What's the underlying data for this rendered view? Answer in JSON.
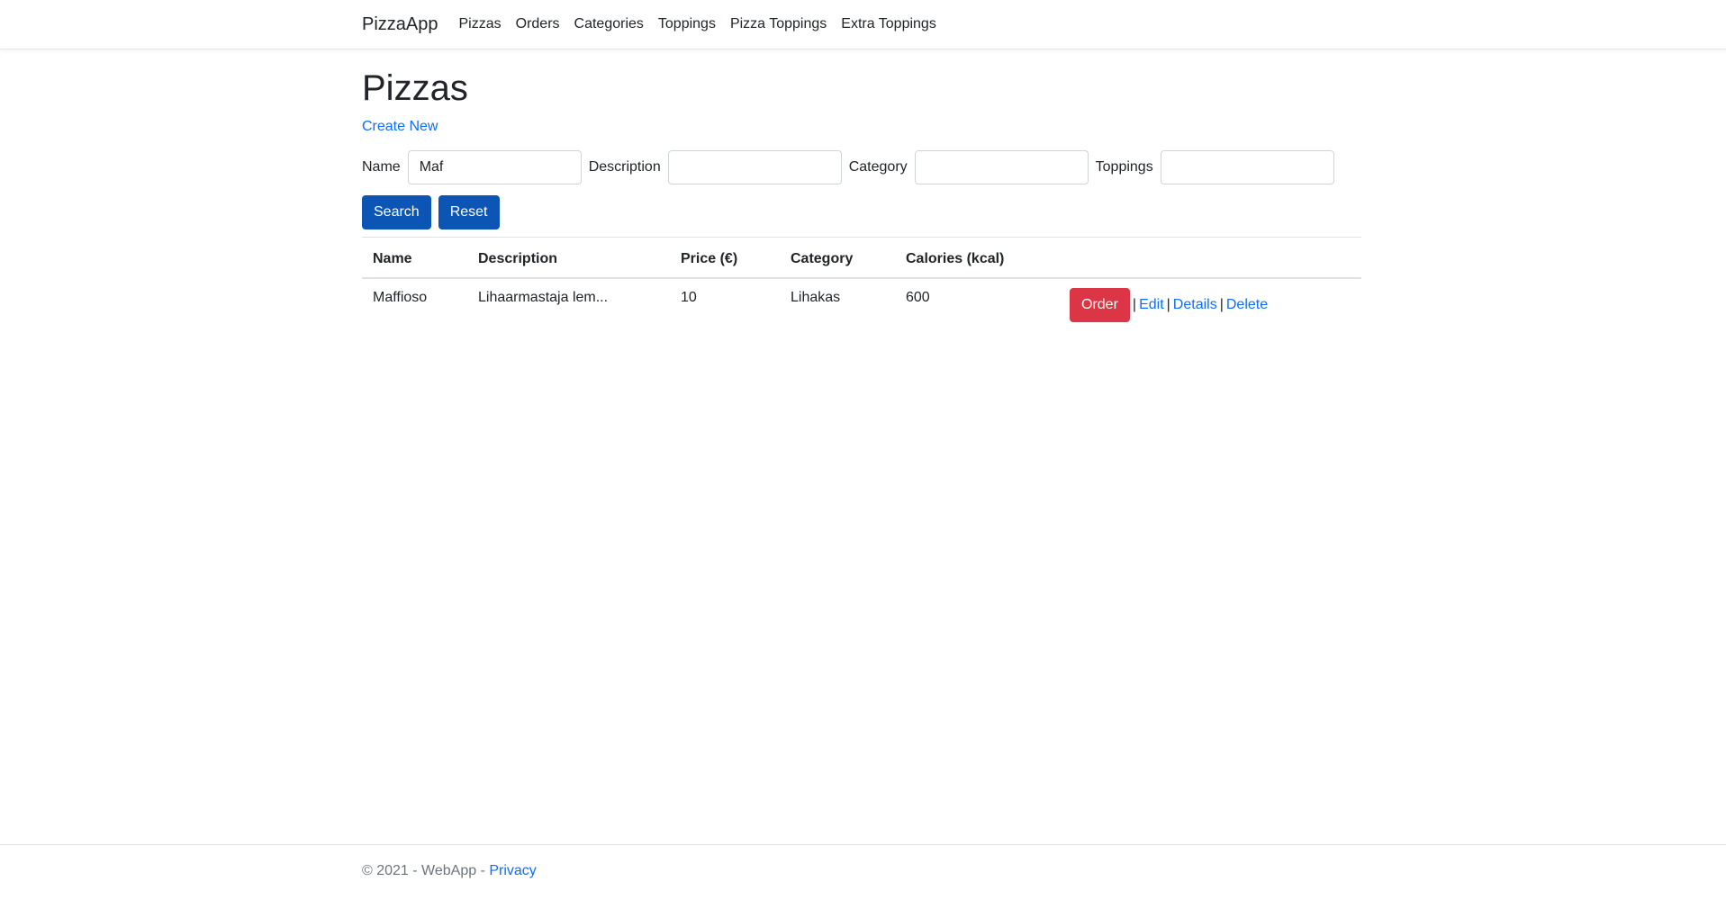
{
  "navbar": {
    "brand": "PizzaApp",
    "links": [
      "Pizzas",
      "Orders",
      "Categories",
      "Toppings",
      "Pizza Toppings",
      "Extra Toppings"
    ]
  },
  "page": {
    "title": "Pizzas",
    "create_new": "Create New"
  },
  "filters": {
    "name_label": "Name",
    "name_value": "Maf",
    "description_label": "Description",
    "description_value": "",
    "category_label": "Category",
    "category_value": "",
    "toppings_label": "Toppings",
    "toppings_value": "",
    "search_label": "Search",
    "reset_label": "Reset"
  },
  "table": {
    "headers": [
      "Name",
      "Description",
      "Price (€)",
      "Category",
      "Calories (kcal)",
      ""
    ],
    "rows": [
      {
        "name": "Maffioso",
        "description": "Lihaarmastaja lem...",
        "price": "10",
        "category": "Lihakas",
        "calories": "600",
        "order_label": "Order",
        "edit_label": "Edit",
        "details_label": "Details",
        "delete_label": "Delete",
        "separator": "|"
      }
    ]
  },
  "footer": {
    "text": "© 2021 - WebApp - ",
    "privacy": "Privacy"
  },
  "colors": {
    "primary": "#0d55b5",
    "danger": "#dc3545",
    "link": "#0d6efd"
  }
}
